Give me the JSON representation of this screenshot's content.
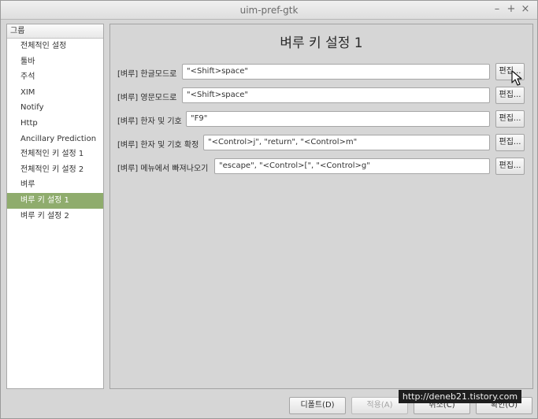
{
  "window": {
    "title": "uim-pref-gtk",
    "minimize_glyph": "–",
    "maximize_glyph": "+",
    "close_glyph": "×"
  },
  "sidebar": {
    "header": "그룹",
    "selected_index": 10,
    "items": [
      {
        "label": "전체적인 설정"
      },
      {
        "label": "툴바"
      },
      {
        "label": "주석"
      },
      {
        "label": "XIM"
      },
      {
        "label": "Notify"
      },
      {
        "label": "Http"
      },
      {
        "label": "Ancillary Prediction"
      },
      {
        "label": "전체적인 키 설정 1"
      },
      {
        "label": "전체적인 키 설정 2"
      },
      {
        "label": "벼루"
      },
      {
        "label": "벼루 키 설정 1"
      },
      {
        "label": "벼루 키 설정 2"
      }
    ]
  },
  "panel": {
    "title": "벼루 키 설정 1",
    "rows": [
      {
        "label": "[벼루] 한글모드로",
        "value": "\"<Shift>space\"",
        "button": "편집..."
      },
      {
        "label": "[벼루] 영문모드로",
        "value": "\"<Shift>space\"",
        "button": "편집..."
      },
      {
        "label": "[벼루] 한자 및 기호",
        "value": "\"F9\"",
        "button": "편집..."
      },
      {
        "label": "[벼루] 한자 및 기호 확정",
        "value": "\"<Control>j\", \"return\", \"<Control>m\"",
        "button": "편집..."
      },
      {
        "label": "[벼루] 메뉴에서 빠져나오기",
        "value": "\"escape\", \"<Control>[\", \"<Control>g\"",
        "button": "편집..."
      }
    ]
  },
  "footer": {
    "defaults": "디폴트(D)",
    "apply": "적용(A)",
    "cancel": "취소(C)",
    "ok": "확인(O)"
  },
  "watermark": "http://deneb21.tistory.com"
}
